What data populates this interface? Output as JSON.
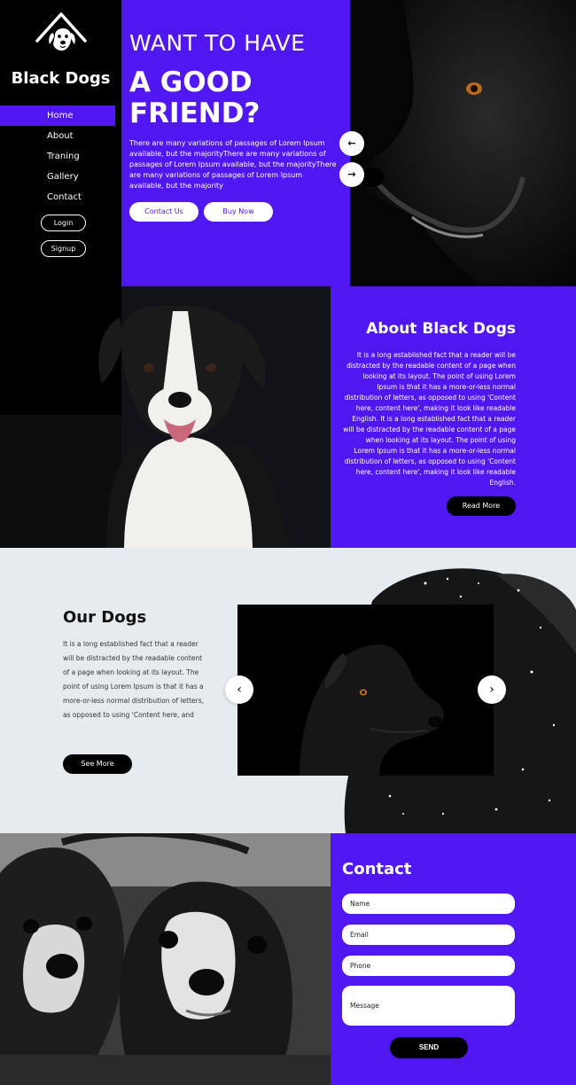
{
  "brand": {
    "name": "Black Dogs",
    "logo_icon": "dog-house-icon"
  },
  "nav": {
    "items": [
      "Home",
      "About",
      "Traning",
      "Gallery",
      "Contact"
    ],
    "active": "Home",
    "login_label": "Login",
    "signup_label": "Signup"
  },
  "hero": {
    "headline_small": "WANT TO HAVE",
    "headline_big_line1": "A GOOD",
    "headline_big_line2": "FRIEND?",
    "text": "There are many variations of passages of Lorem Ipsum available, but the majorityThere are many variations of passages of Lorem Ipsum available, but the majorityThere are many variations of passages of Lorem Ipsum available, but the majority",
    "contact_label": "Contact Us",
    "buy_label": "Buy Now",
    "prev_arrow": "←",
    "next_arrow": "→"
  },
  "about": {
    "title": "About Black Dogs",
    "text": "It is a long established fact that a reader will be distracted by the readable content of a page when looking at its layout. The point of using Lorem Ipsum is that it has a more-or-less normal distribution of letters, as opposed to using 'Content here, content here', making it look like readable English. It is a long established fact that a reader will be distracted by the readable content of a page when looking at its layout. The point of using Lorem Ipsum is that it has a more-or-less normal distribution of letters, as opposed to using 'Content here, content here', making it look like readable English.",
    "button_label": "Read More"
  },
  "our_dogs": {
    "title": "Our Dogs",
    "text": "It is a long established fact that a reader will be distracted by the readable content of a page when looking at its layout. The point of using Lorem Ipsum is that it has a more-or-less normal distribution of letters, as opposed to using 'Content here, and",
    "button_label": "See More",
    "prev": "‹",
    "next": "›"
  },
  "contact": {
    "title": "Contact",
    "name_placeholder": "Name",
    "email_placeholder": "Email",
    "phone_placeholder": "Phone",
    "message_placeholder": "Message",
    "send_label": "SEND"
  },
  "colors": {
    "accent": "#5117f2",
    "dark": "#000000",
    "light_bg": "#e6ebf0"
  }
}
